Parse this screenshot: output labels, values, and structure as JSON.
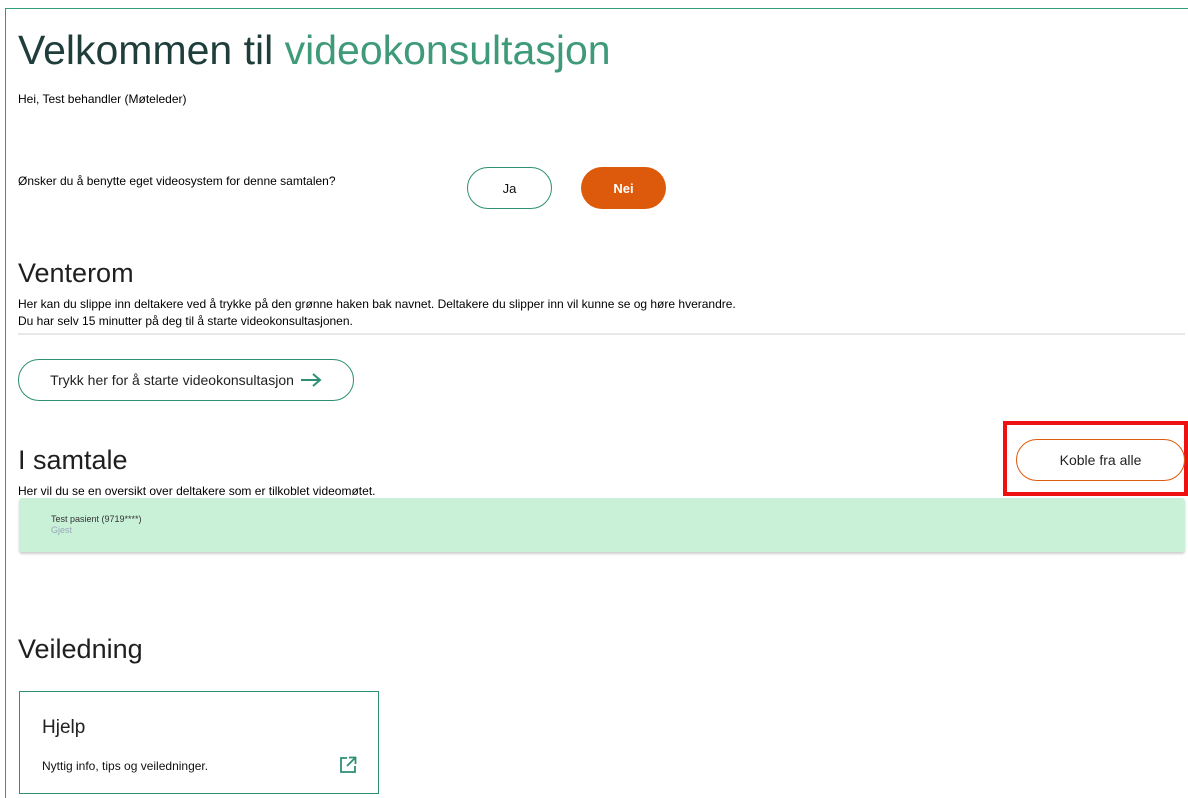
{
  "header": {
    "title_main": "Velkommen til ",
    "title_accent": "videokonsultasjon",
    "greeting": "Hei, Test behandler (Møteleder)"
  },
  "video_system": {
    "question": "Ønsker du å benytte eget videosystem for denne samtalen?",
    "yes_label": "Ja",
    "no_label": "Nei",
    "selected": "Nei"
  },
  "waiting_room": {
    "title": "Venterom",
    "line1": "Her kan du slippe inn deltakere ved å trykke på den grønne haken bak navnet. Deltakere du slipper inn vil kunne se og høre hverandre.",
    "line2": "Du har selv 15 minutter på deg til å starte videokonsultasjonen.",
    "start_button": "Trykk her for å starte videokonsultasjon",
    "start_icon": "arrow-right-icon"
  },
  "in_call": {
    "title": "I samtale",
    "description": "Her vil du se en oversikt over deltakere som er tilkoblet videomøtet.",
    "disconnect_all": "Koble fra alle",
    "participants": [
      {
        "name": "Test pasient (9719****)",
        "role": "Gjest"
      }
    ]
  },
  "guidance": {
    "title": "Veiledning",
    "card_title": "Hjelp",
    "card_description": "Nyttig info, tips og veiledninger.",
    "card_icon": "external-link-icon"
  },
  "colors": {
    "accent_green": "#3e9a78",
    "border_green": "#2f8f74",
    "orange": "#dd5a0c",
    "participant_bg": "#c8f1d8",
    "highlight_red": "#ee1111"
  }
}
